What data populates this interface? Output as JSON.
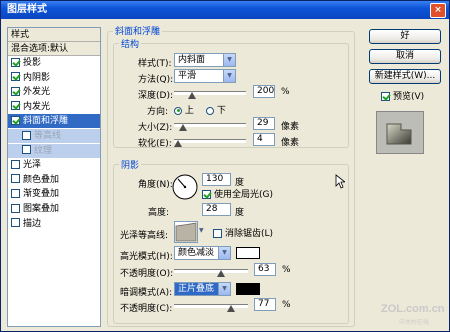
{
  "window": {
    "title": "图层样式",
    "close_glyph": "×"
  },
  "style_list": {
    "header": "样式",
    "blend_options": "混合选项:默认",
    "items": [
      {
        "label": "投影",
        "checked": true
      },
      {
        "label": "内阴影",
        "checked": true
      },
      {
        "label": "外发光",
        "checked": true
      },
      {
        "label": "内发光",
        "checked": true
      },
      {
        "label": "斜面和浮雕",
        "checked": true,
        "selected": true
      },
      {
        "label": "等高线",
        "checked": false,
        "sub": true
      },
      {
        "label": "纹理",
        "checked": false,
        "sub": true
      },
      {
        "label": "光泽",
        "checked": false
      },
      {
        "label": "颜色叠加",
        "checked": false
      },
      {
        "label": "渐变叠加",
        "checked": false
      },
      {
        "label": "图案叠加",
        "checked": false
      },
      {
        "label": "描边",
        "checked": false
      }
    ]
  },
  "bevel": {
    "group_title": "斜面和浮雕",
    "structure_title": "结构",
    "style_label": "样式(T):",
    "style_value": "内斜面",
    "technique_label": "方法(Q):",
    "technique_value": "平滑",
    "depth_label": "深度(D):",
    "depth_value": "200",
    "depth_unit": "%",
    "depth_fraction": 0.25,
    "direction_label": "方向:",
    "dir_up": "上",
    "dir_down": "下",
    "size_label": "大小(Z):",
    "size_value": "29",
    "size_unit": "像素",
    "size_fraction": 0.12,
    "soften_label": "软化(E):",
    "soften_value": "4",
    "soften_unit": "像素",
    "soften_fraction": 0.05
  },
  "shading": {
    "title": "阴影",
    "angle_label": "角度(N):",
    "angle_value": "130",
    "angle_unit": "度",
    "global_light_label": "使用全局光(G)",
    "altitude_label": "高度:",
    "altitude_value": "28",
    "altitude_unit": "度",
    "gloss_contour_label": "光泽等高线:",
    "anti_alias_label": "消除锯齿(L)",
    "highlight_mode_label": "高光模式(H):",
    "highlight_mode_value": "颜色减淡",
    "highlight_color": "#ffffff",
    "highlight_opacity_label": "不透明度(O):",
    "highlight_opacity_value": "63",
    "highlight_opacity_fraction": 0.63,
    "shadow_mode_label": "暗调模式(A):",
    "shadow_mode_value": "正片叠底",
    "shadow_color": "#000000",
    "shadow_opacity_label": "不透明度(C):",
    "shadow_opacity_value": "77",
    "shadow_opacity_fraction": 0.77,
    "percent": "%"
  },
  "buttons": {
    "ok": "好",
    "cancel": "取消",
    "new_style": "新建样式(W)...",
    "preview_label": "预览(V)"
  },
  "watermark": {
    "text": "ZOL.com.cn",
    "sub": "中关村在线"
  }
}
